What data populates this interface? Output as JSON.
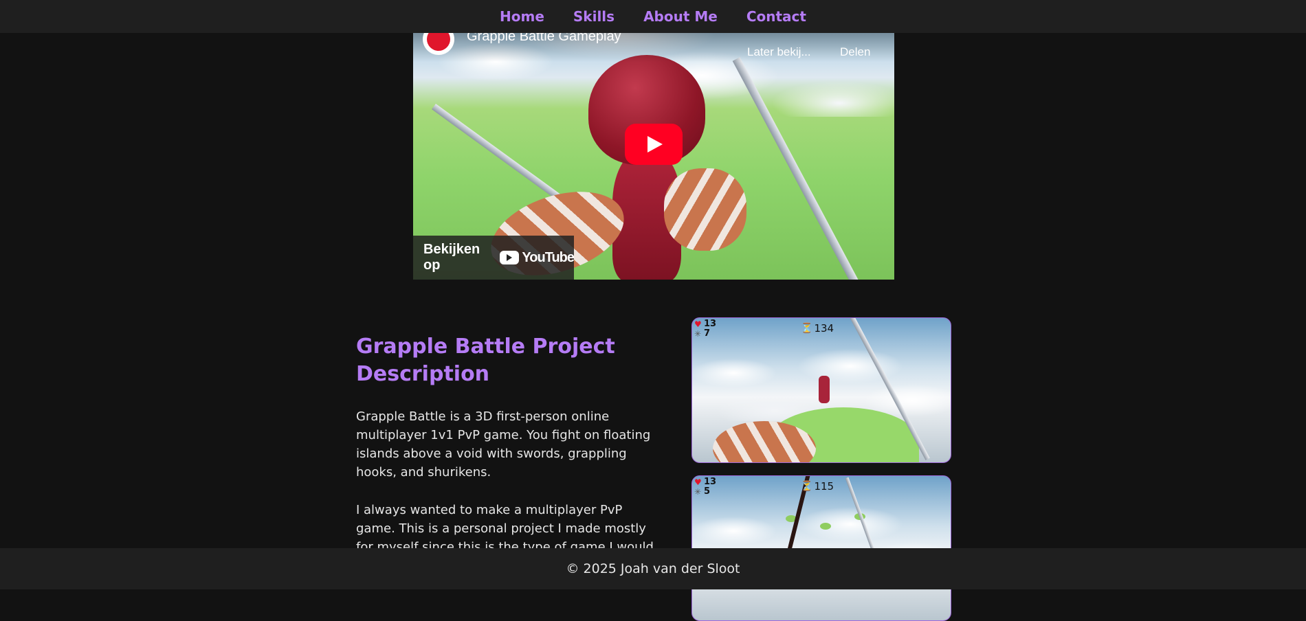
{
  "nav": {
    "items": [
      {
        "label": "Home"
      },
      {
        "label": "Skills"
      },
      {
        "label": "About Me"
      },
      {
        "label": "Contact"
      }
    ]
  },
  "video": {
    "title": "Grapple Battle Gameplay",
    "watch_later_label": "Later bekij...",
    "share_label": "Delen",
    "watch_on_label": "Bekijken op",
    "youtube_logo_text": "YouTube",
    "play_button_color": "#ff0022"
  },
  "project": {
    "title": "Grapple Battle Project Description",
    "paragraphs": [
      "Grapple Battle is a 3D first-person online multiplayer 1v1 PvP game. You fight on floating islands above a void with swords, grappling hooks, and shurikens.",
      "I always wanted to make a multiplayer PvP game. This is a personal project I made mostly for myself since this is the type of game I would"
    ]
  },
  "screenshots": [
    {
      "health": "13",
      "shurikens": "7",
      "timer": "134"
    },
    {
      "health": "13",
      "shurikens": "5",
      "timer": "115"
    }
  ],
  "footer": {
    "text": "© 2025 Joah van der Sloot"
  },
  "colors": {
    "accent": "#b57cf5",
    "background": "#121212",
    "bar": "#1f1f1f"
  }
}
